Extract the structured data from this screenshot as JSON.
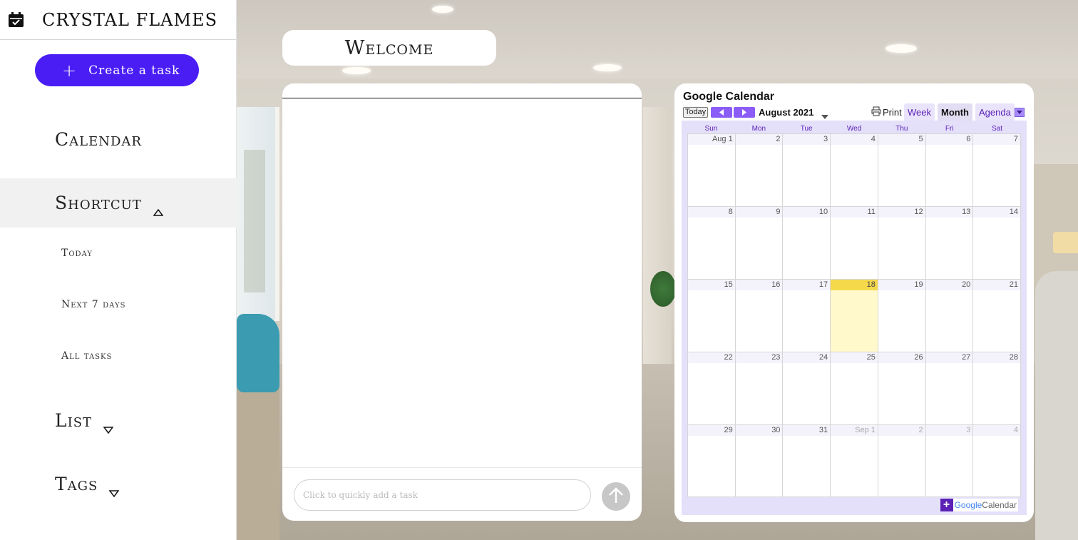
{
  "sidebar": {
    "brand": "CRYSTAL FLAMES",
    "create_label": "Create a task",
    "nav": {
      "calendar": "Calendar",
      "shortcut": "Shortcut",
      "today": "Today",
      "next7": "Next 7 days",
      "all_tasks": "All tasks",
      "list": "List",
      "tags": "Tags"
    }
  },
  "welcome": "Welcome",
  "tasks": {
    "quick_add_placeholder": "Click to quickly add a task"
  },
  "calendar": {
    "title": "Google Calendar",
    "today_label": "Today",
    "month_label": "August 2021",
    "print_label": "Print",
    "views": [
      "Week",
      "Month",
      "Agenda"
    ],
    "active_view": "Month",
    "weekdays": [
      "Sun",
      "Mon",
      "Tue",
      "Wed",
      "Thu",
      "Fri",
      "Sat"
    ],
    "weeks": [
      [
        "Aug 1",
        "2",
        "3",
        "4",
        "5",
        "6",
        "7"
      ],
      [
        "8",
        "9",
        "10",
        "11",
        "12",
        "13",
        "14"
      ],
      [
        "15",
        "16",
        "17",
        "18",
        "19",
        "20",
        "21"
      ],
      [
        "22",
        "23",
        "24",
        "25",
        "26",
        "27",
        "28"
      ],
      [
        "29",
        "30",
        "31",
        "Sep 1",
        "2",
        "3",
        "4"
      ]
    ],
    "today_cell": "18",
    "badge_google": "Google",
    "badge_calendar": "Calendar"
  },
  "colors": {
    "accent": "#4a1df5",
    "calendar_purple": "#8b5cf6",
    "today_highlight": "#f5d94a"
  }
}
